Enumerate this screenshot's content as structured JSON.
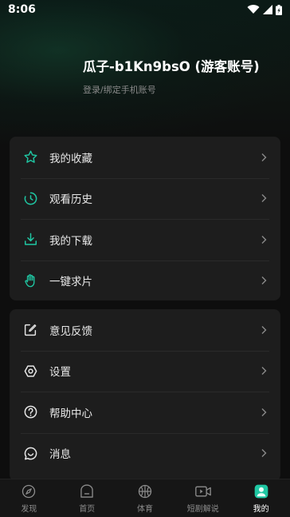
{
  "status_bar": {
    "time": "8:06"
  },
  "profile": {
    "name": "瓜子-b1Kn9bsO (游客账号)",
    "login_hint": "登录/绑定手机账号"
  },
  "menu_primary": [
    {
      "label": "我的收藏",
      "icon": "star-icon"
    },
    {
      "label": "观看历史",
      "icon": "history-clock-icon"
    },
    {
      "label": "我的下载",
      "icon": "download-icon"
    },
    {
      "label": "一键求片",
      "icon": "hand-icon"
    }
  ],
  "menu_secondary": [
    {
      "label": "意见反馈",
      "icon": "edit-feedback-icon"
    },
    {
      "label": "设置",
      "icon": "settings-icon"
    },
    {
      "label": "帮助中心",
      "icon": "help-icon"
    },
    {
      "label": "消息",
      "icon": "message-icon"
    }
  ],
  "tabbar": {
    "items": [
      {
        "label": "发现",
        "icon": "compass-icon"
      },
      {
        "label": "首页",
        "icon": "home-icon"
      },
      {
        "label": "体育",
        "icon": "basketball-icon"
      },
      {
        "label": "短剧解说",
        "icon": "video-icon"
      },
      {
        "label": "我的",
        "icon": "profile-icon"
      }
    ],
    "active": "我的"
  },
  "colors": {
    "accent": "#1fc7a3",
    "card_bg": "#1d1d1d",
    "page_bg": "#0e0e0e"
  }
}
